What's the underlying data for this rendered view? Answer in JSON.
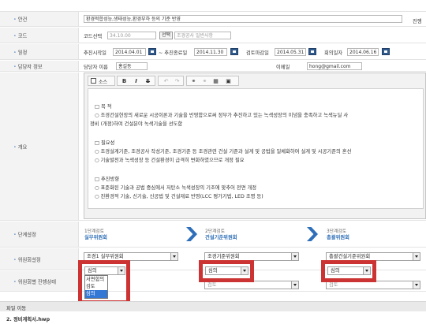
{
  "case": {
    "label": "안건",
    "value": "환경적합성능,생태성능,환경부하 등의 기준 반영",
    "right_label": "진행"
  },
  "code": {
    "label": "코드",
    "code_select_value": "34.10.00",
    "select_button": "선택",
    "code_name": "조경공사 일반사항"
  },
  "schedule": {
    "label": "일정",
    "start_label": "추진시작일",
    "start_value": "2014.04.01",
    "end_label": "~ 추진종료일",
    "end_value": "2014.11.30",
    "review_deadline_label": "검토마감일",
    "review_deadline_value": "2014.05.31",
    "meeting_label": "회의일자",
    "meeting_value": "2014.06.16"
  },
  "manager": {
    "label": "담당자 정보",
    "name_label": "담당자 이름",
    "name_value": "홍길동",
    "email_label": "이메일",
    "email_value": "hong@gmail.com"
  },
  "summary": {
    "label": "개요",
    "toolbar": {
      "source_label": "소스",
      "bold": "B",
      "italic": "I",
      "strike": "S"
    },
    "lines": [
      "□ 목 적",
      "○ 조경건설현장의 새로운 시공이론과 기술을 반영함으로써 정부가 추진하고 있는 녹색성장의 이념을 충족하고 녹색뉴딜 사",
      "정비 (개정)하여 건설분야 녹색기술을 선도함",
      "□ 필요성",
      "○ 조경설계기준, 조경공사 작성기준, 조경기준 등 조경관련 건설 기준과 설계 및 공법을 일체화하여 설계 및 시공기준의 혼선",
      "○ 기술발전과 녹색성장 등 건설환경이 급격히 변화하였으므로 개정 필요",
      "□ 추진방향",
      "○ 표준화된 기술과 공법 중심에서 저탄소 녹색성장의 기조에 맞추어 전면 개정",
      "○ 친환경적 기술, 신기술, 신공법 및 건설재료 반영(LCC 평가기법, LED 조명 등)"
    ]
  },
  "stage": {
    "label": "단계설정",
    "steps": [
      {
        "small": "1단계검토",
        "name": "실무위원회"
      },
      {
        "small": "2단계검토",
        "name": "건설기준위원회"
      },
      {
        "small": "3단계검토",
        "name": "총괄위원회"
      }
    ]
  },
  "committee": {
    "label": "위원회설정",
    "selects": [
      "조경1 실무위원회",
      "조경기준위원회",
      "총괄건설기준위원회"
    ]
  },
  "status": {
    "label": "위원회별 진행상태",
    "values": [
      "심의",
      "심의",
      "심의"
    ],
    "dropdown_options": [
      "서면합의",
      "검토",
      "심의"
    ],
    "row_values": [
      "검토",
      "검토"
    ]
  },
  "file_move": {
    "label": "파일 이동"
  },
  "file_name": "2. 정비계획서.hwp"
}
